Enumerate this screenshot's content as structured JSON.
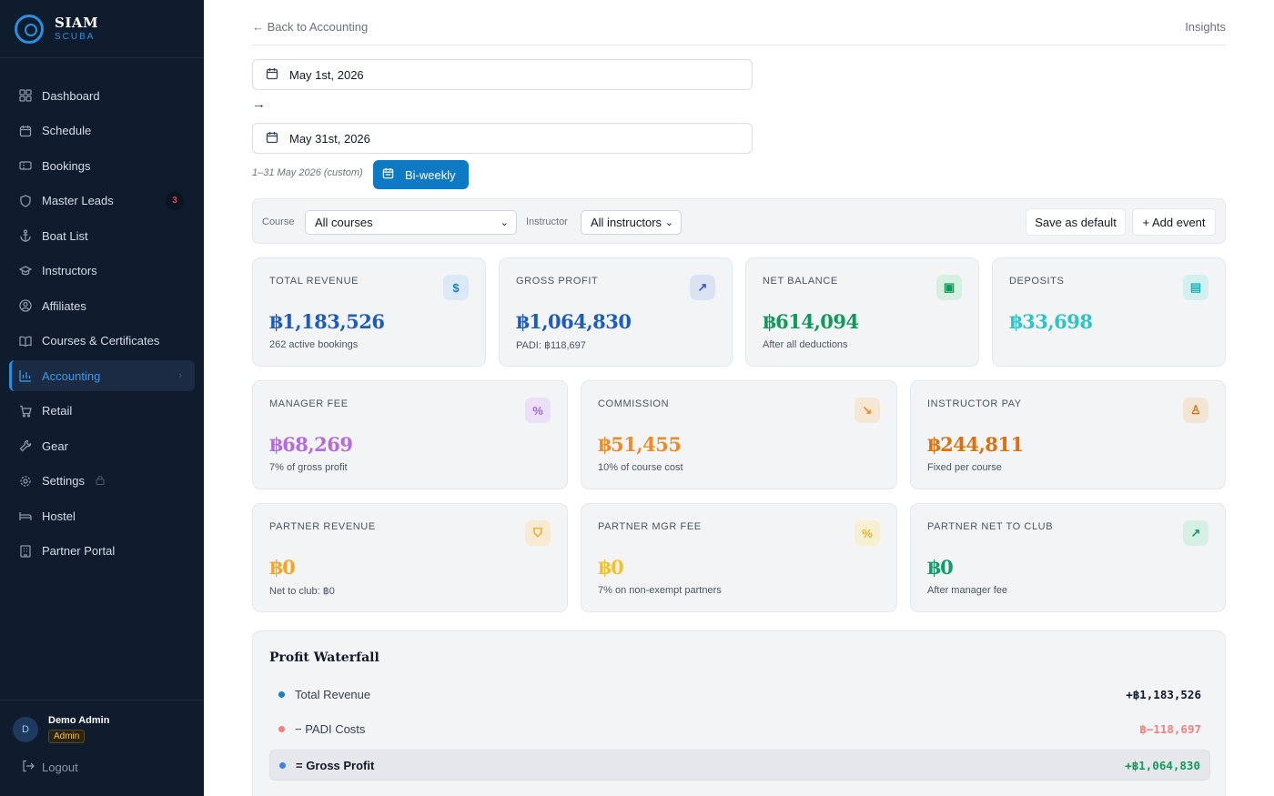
{
  "brand": {
    "title": "SIAM",
    "subtitle": "SCUBA",
    "logo_mark": "Siam"
  },
  "sidebar": {
    "items": [
      {
        "label": "Dashboard",
        "icon": "grid-icon"
      },
      {
        "label": "Schedule",
        "icon": "calendar-icon"
      },
      {
        "label": "Bookings",
        "icon": "ticket-icon"
      },
      {
        "label": "Master Leads",
        "icon": "shield-icon",
        "badge": "3"
      },
      {
        "label": "Boat List",
        "icon": "anchor-icon"
      },
      {
        "label": "Instructors",
        "icon": "graduation-cap-icon"
      },
      {
        "label": "Affiliates",
        "icon": "user-circle-icon"
      },
      {
        "label": "Courses & Certificates",
        "icon": "book-icon"
      },
      {
        "label": "Accounting",
        "icon": "bar-chart-icon",
        "active": true
      },
      {
        "label": "Retail",
        "icon": "cart-icon"
      },
      {
        "label": "Gear",
        "icon": "wrench-icon"
      },
      {
        "label": "Settings",
        "icon": "gear-icon",
        "locked": true
      },
      {
        "label": "Hostel",
        "icon": "bed-icon"
      },
      {
        "label": "Partner Portal",
        "icon": "building-icon"
      }
    ],
    "user": {
      "initial": "D",
      "name": "Demo Admin",
      "role": "Admin"
    },
    "logout_label": "Logout"
  },
  "topbar": {
    "back_label": "← Back to Accounting",
    "insights_label": "Insights"
  },
  "date_range": {
    "start": "May 1st, 2026",
    "arrow": "→",
    "end": "May 31st, 2026",
    "range_label": "1–31 May 2026 (custom)",
    "preset_label": "Bi-weekly"
  },
  "filters": {
    "course_label": "Course",
    "course_value": "All courses",
    "instructor_label": "Instructor",
    "instructor_value": "All instructors",
    "save_default_label": "Save as default",
    "add_event_label": "+ Add event"
  },
  "cards": [
    {
      "label": "TOTAL REVENUE",
      "value": "฿1,183,526",
      "sub": "262 active bookings",
      "color": "#1d5bbf",
      "icon": "$",
      "icon_name": "dollar-icon",
      "icon_bg": "#dbe8f5",
      "icon_color": "#1b7fc0"
    },
    {
      "label": "GROSS PROFIT",
      "value": "฿1,064,830",
      "sub": "PADI: ฿118,697",
      "color": "#1d5bbf",
      "icon": "↗",
      "icon_name": "trend-up-icon",
      "icon_bg": "#dbe3f2",
      "icon_color": "#3b5bbf"
    },
    {
      "label": "NET BALANCE",
      "value": "฿614,094",
      "sub": "After all deductions",
      "color": "#0f9a5a",
      "icon": "▣",
      "icon_name": "wallet-icon",
      "icon_bg": "#d5efe1",
      "icon_color": "#0f9a5a"
    },
    {
      "label": "DEPOSITS",
      "value": "฿33,698",
      "sub": "",
      "color": "#2cc5c7",
      "icon": "▤",
      "icon_name": "receipt-icon",
      "icon_bg": "#d3f0f0",
      "icon_color": "#1fb5b8"
    },
    {
      "label": "MANAGER FEE",
      "value": "฿68,269",
      "sub": "7% of gross profit",
      "color": "#b66ae0",
      "icon": "%",
      "icon_name": "percent-icon",
      "icon_bg": "#ebe0f5",
      "icon_color": "#a26ad6"
    },
    {
      "label": "COMMISSION",
      "value": "฿51,455",
      "sub": "10% of course cost",
      "color": "#f08a24",
      "icon": "↘",
      "icon_name": "trend-down-icon",
      "icon_bg": "#f6e6d4",
      "icon_color": "#f08a24"
    },
    {
      "label": "INSTRUCTOR PAY",
      "value": "฿244,811",
      "sub": "Fixed per course",
      "color": "#d9710f",
      "icon": "♙",
      "icon_name": "award-icon",
      "icon_bg": "#f3e5d3",
      "icon_color": "#d9710f"
    },
    {
      "label": "PARTNER REVENUE",
      "value": "฿0",
      "sub": "Net to club: ฿0",
      "color": "#f4a623",
      "icon": "⛉",
      "icon_name": "handshake-icon",
      "icon_bg": "#f7ead0",
      "icon_color": "#e3a21a"
    },
    {
      "label": "PARTNER MGR FEE",
      "value": "฿0",
      "sub": "7% on non-exempt partners",
      "color": "#f4c12c",
      "icon": "%",
      "icon_name": "percent-icon",
      "icon_bg": "#f6efd2",
      "icon_color": "#e6b422"
    },
    {
      "label": "PARTNER NET TO CLUB",
      "value": "฿0",
      "sub": "After manager fee",
      "color": "#119a6a",
      "icon": "↗",
      "icon_name": "trend-up-icon",
      "icon_bg": "#d6efe4",
      "icon_color": "#119a6a"
    }
  ],
  "waterfall": {
    "title": "Profit Waterfall",
    "rows": [
      {
        "label": "Total Revenue",
        "value": "+฿1,183,526",
        "dot": "#1b7fc0",
        "value_color": "#111827"
      },
      {
        "label": "− PADI Costs",
        "value": "฿−118,697",
        "dot": "#f08080",
        "value_color": "#f08080"
      },
      {
        "label": "= Gross Profit",
        "value": "+฿1,064,830",
        "dot": "#3b82f6",
        "value_color": "#0f9a5a",
        "highlight": true
      }
    ]
  },
  "colors": {
    "sidebar_bg": "#0f1c2e",
    "accent": "#0e7ac4",
    "active_text": "#3b9be6"
  }
}
